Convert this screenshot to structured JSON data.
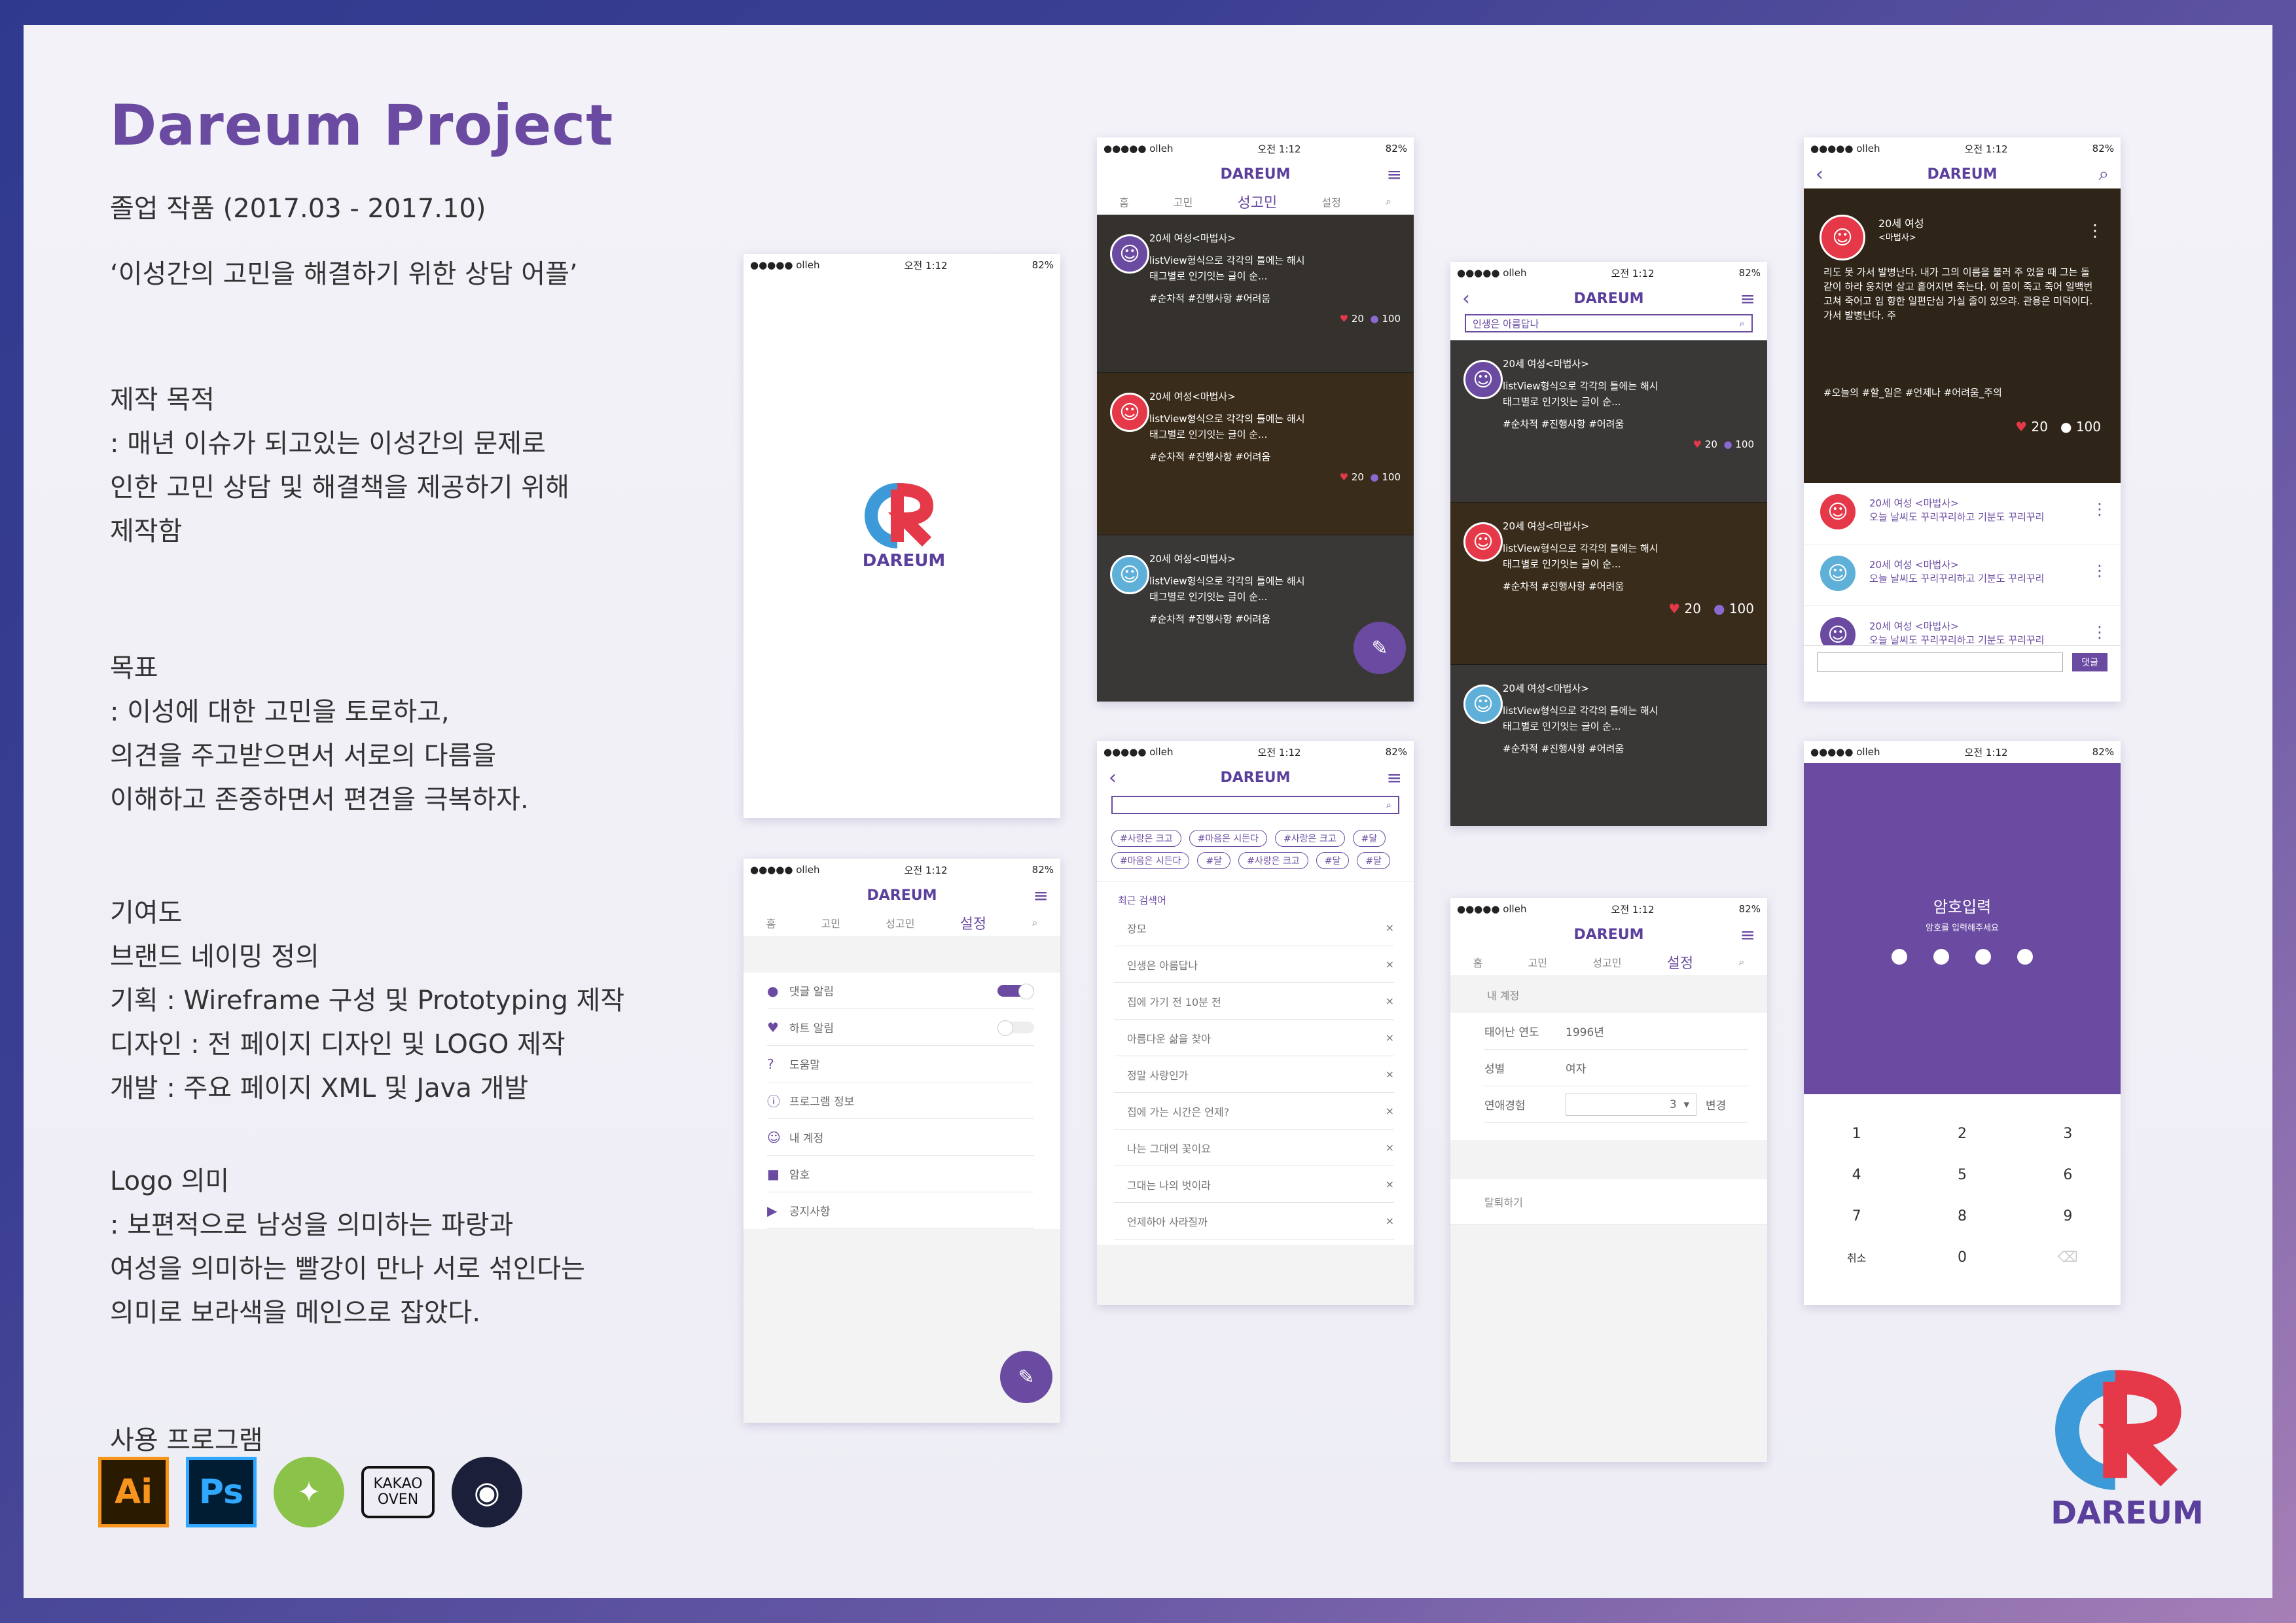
{
  "title": "Dareum  Project",
  "subtitle": "졸업 작품 (2017.03 - 2017.10)",
  "tagline": "‘이성간의 고민을 해결하기 위한 상담 어플’",
  "purpose": {
    "heading": "제작 목적",
    "lines": [
      ": 매년 이슈가 되고있는 이성간의 문제로",
      "인한 고민 상담 및 해결책을 제공하기 위해",
      "제작함"
    ]
  },
  "goal": {
    "heading": "목표",
    "lines": [
      ": 이성에 대한 고민을 토로하고,",
      "의견을 주고받으면서 서로의 다름을",
      "이해하고 존중하면서 편견을 극복하자."
    ]
  },
  "contribution": {
    "heading": "기여도",
    "lines": [
      "브랜드 네이밍 정의",
      "기획 : Wireframe 구성 및 Prototyping 제작",
      "디자인 : 전 페이지 디자인 및 LOGO 제작",
      "개발 : 주요 페이지 XML 및 Java 개발"
    ]
  },
  "logo_meaning": {
    "heading": "Logo 의미",
    "lines": [
      ": 보편적으로 남성을 의미하는 파랑과",
      "여성을 의미하는 빨강이 만나 서로 섞인다는",
      "의미로 보라색을 메인으로 잡았다."
    ]
  },
  "programs": {
    "heading": "사용 프로그램",
    "items": [
      {
        "label": "Ai",
        "icon": "illustrator-icon"
      },
      {
        "label": "Ps",
        "icon": "photoshop-icon"
      },
      {
        "label": "",
        "icon": "android-studio-icon"
      },
      {
        "label": "KAKAO\nOVEN",
        "icon": "kakao-oven-icon"
      },
      {
        "label": "",
        "icon": "github-icon"
      }
    ]
  },
  "colors": {
    "brand": "#6a4ba1",
    "blue": "#3d9ad8",
    "red": "#e53848"
  },
  "status": {
    "carrier": "●●●●● olleh",
    "time": "오전 1:12",
    "battery": "82%"
  },
  "brand": "DAREUM",
  "tabs": [
    "홈",
    "고민",
    "성고민",
    "설정"
  ],
  "feed": {
    "author": "20세 여성<마법사>",
    "line1": "listView형식으로 각각의 틀에는 해시",
    "line2": "태그별로 인기잇는 글이 순...",
    "tags": "#순차적 #진행사항 #어려움",
    "likes": "20",
    "comments": "100"
  },
  "search_placeholder": "인생은 아름답나",
  "settings": {
    "items": [
      "댓글 알림",
      "하트 알림",
      "도움말",
      "프로그램 정보",
      "내 계정",
      "암호",
      "공지사항"
    ]
  },
  "search_screen": {
    "chips_row1": [
      "#사랑은 크고",
      "#마음은 시든다",
      "#사랑은 크고",
      "#달"
    ],
    "chips_row2": [
      "#마음은 시든다",
      "#달",
      "#사랑은 크고",
      "#달",
      "#달"
    ],
    "recent_label": "최근 검색어",
    "recent": [
      "장모",
      "인생은 아름답나",
      "집에 가기 전 10분 전",
      "아름다운 삶을 찾아",
      "정말 사랑인가",
      "집에 가는 시간은 언제?",
      "나는 그대의 꽃이요",
      "그대는 나의 벗이라",
      "언제하아 사라질까"
    ],
    "close": "×"
  },
  "detail": {
    "author": "20세 여성",
    "nick": "<마법사>",
    "body": "리도 못 가서 발병난다. 내가 그의 이름을 불러 주 었을 때 그는 돌같이 하라 웅치면 살고 흩어지면 죽는다. 이 몸이 죽고 죽어 일백번 고쳐 죽어고 임 향한 일편단심 가실 줄이 있으랴. 관용은 미덕이다. 가서 발병난다. 주",
    "tags": "#오늘의 #할_일은 #언제나 #어려움_주의",
    "likes": "20",
    "comments": "100",
    "replies": [
      {
        "author": "20세 여성 <마법사>",
        "text": "오늘 날씨도 꾸리꾸리하고 기분도 꾸리꾸리"
      },
      {
        "author": "20세 여성 <마법사>",
        "text": "오늘 날씨도 꾸리꾸리하고 기분도 꾸리꾸리"
      },
      {
        "author": "20세 여성 <마법사>",
        "text": "오늘 날씨도 꾸리꾸리하고 기분도 꾸리꾸리"
      }
    ],
    "reply_button": "댓글"
  },
  "account": {
    "section": "내 계정",
    "birth_label": "태어난 연도",
    "birth_value": "1996년",
    "gender_label": "성별",
    "gender_value": "여자",
    "exp_label": "연애경험",
    "exp_value": "3",
    "change": "변경",
    "withdraw": "탈퇴하기"
  },
  "pin": {
    "title": "암호입력",
    "hint": "암호를 입력해주세요",
    "keys": [
      "1",
      "2",
      "3",
      "4",
      "5",
      "6",
      "7",
      "8",
      "9",
      "취소",
      "0",
      "⌫"
    ]
  }
}
